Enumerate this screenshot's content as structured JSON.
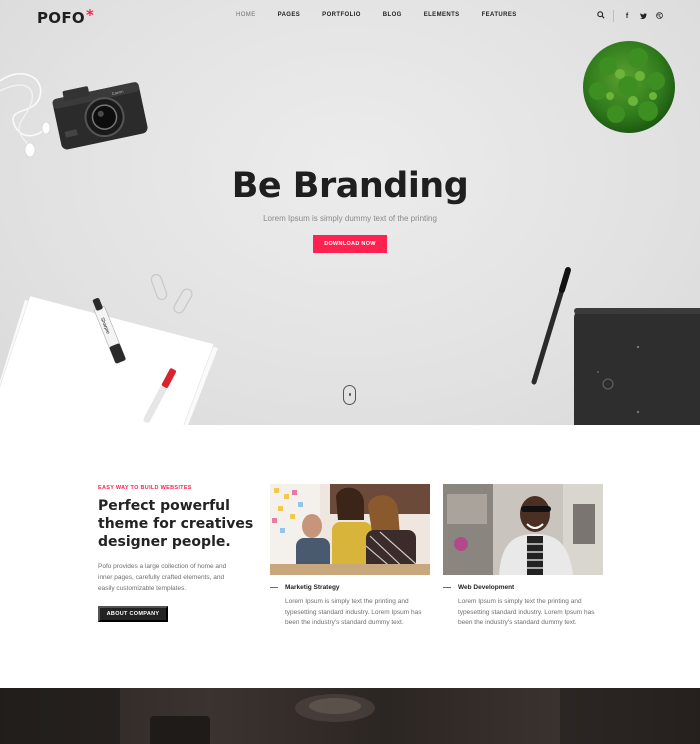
{
  "nav": {
    "logo": "POFO",
    "logo_mark": "*",
    "items": [
      {
        "label": "HOME",
        "active": true
      },
      {
        "label": "PAGES"
      },
      {
        "label": "PORTFOLIO"
      },
      {
        "label": "BLOG"
      },
      {
        "label": "ELEMENTS"
      },
      {
        "label": "FEATURES"
      }
    ],
    "icons": [
      "search-icon",
      "facebook-icon",
      "twitter-icon",
      "dribbble-icon"
    ]
  },
  "hero": {
    "title": "Be Branding",
    "subtitle": "Lorem Ipsum is simply dummy text of the printing",
    "cta": "DOWNLOAD NOW"
  },
  "about": {
    "eyebrow": "EASY WAY TO BUILD WEBSITES",
    "title": "Perfect powerful theme for creatives designer people.",
    "text": "Pofo provides a large collection of home and inner pages, carefully crafted elements, and easily customizable templates.",
    "button": "ABOUT COMPANY"
  },
  "cards": [
    {
      "title": "Marketig Strategy",
      "text": "Lorem Ipsum is simply text the printing and typesetting standard industry. Lorem Ipsum has been the industry's standard dummy text."
    },
    {
      "title": "Web Development",
      "text": "Lorem Ipsum is simply text the printing and typesetting standard industry. Lorem Ipsum has been the industry's standard dummy text."
    }
  ],
  "colors": {
    "accent": "#ff214f",
    "dark": "#232323",
    "hero_bg": "#e4e4e4",
    "text_muted": "#6f6f6f"
  }
}
